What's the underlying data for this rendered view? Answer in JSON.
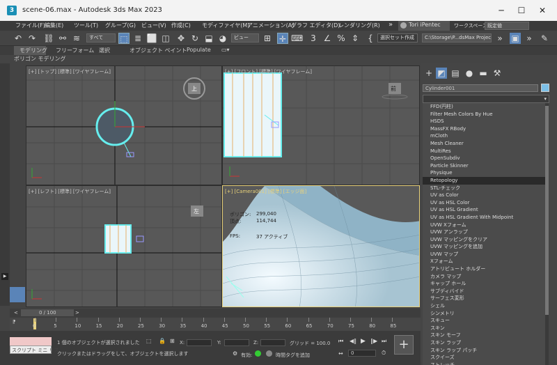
{
  "window": {
    "title": "scene-06.max - Autodesk 3ds Max 2023",
    "logo": "3"
  },
  "menu": [
    "ファイル(F)",
    "編集(E)",
    "ツール(T)",
    "グループ(G)",
    "ビュー(V)",
    "作成(C)",
    "モディファイヤ(M)",
    "アニメーション(A)",
    "グラフ エディタ(D)",
    "レンダリング(R)"
  ],
  "menu_right": {
    "user": "Tori iPentec",
    "workspace_label": "ワークスペース:",
    "workspace_value": "既定値"
  },
  "toolbar": {
    "filter_select": "すべて",
    "view_select": "ビュー",
    "selection_set": "選択セット作成",
    "project_path": "C:\\Storage\\P...dsMax Project"
  },
  "ribbon": {
    "tabs": [
      "モデリング",
      "フリーフォーム",
      "選択",
      "オブジェクト ペイント",
      "Populate"
    ],
    "sub": "ポリゴン モデリング"
  },
  "viewports": {
    "top": "[+] [トップ] [標準] [ワイヤフレーム]",
    "front": "[+] [フロント] [標準] [ワイヤフレーム]",
    "left": "[+] [レフト] [標準] [ワイヤフレーム]",
    "camera": "[+] [Camera001] [標準] [エッジ面]",
    "cam_stats": [
      [
        "ポリゴン:",
        "299,040"
      ],
      [
        "頂点:",
        "114,744"
      ]
    ],
    "fps_label": "FPS:",
    "fps_value": "37 アクティブ",
    "cube_top": "上",
    "cube_front": "前",
    "cube_left": "左"
  },
  "cmdpanel": {
    "object_name": "Cylinder001",
    "modifier_list": [
      "FFD(円柱)",
      "Filter Mesh Colors By Hue",
      "HSDS",
      "MassFX RBody",
      "mCloth",
      "Mesh Cleaner",
      "MultiRes",
      "OpenSubdiv",
      "Particle Skinner",
      "Physique",
      "Retopology",
      "STL-チェック",
      "UV as Color",
      "UV as HSL Color",
      "UV as HSL Gradient",
      "UV as HSL Gradient With Midpoint",
      "UVW Xフォーム",
      "UVW アンラップ",
      "UVW マッピングをクリア",
      "UVW マッピングを追加",
      "UVW マップ",
      "Xフォーム",
      "アトリビュート ホルダー",
      "カメラ マップ",
      "キャップ ホール",
      "サブディバイド",
      "サーフェス変形",
      "シェル",
      "シンメトリ",
      "スキュー",
      "スキン",
      "スキン モーフ",
      "スキン ラップ",
      "スキン ラップ パッチ",
      "スクイーズ",
      "ストレッチ"
    ],
    "selected_index": 10
  },
  "timeline": {
    "frame": "0 / 100",
    "ticks": [
      "0",
      "5",
      "10",
      "15",
      "20",
      "25",
      "30",
      "35",
      "40",
      "45",
      "50",
      "55",
      "60",
      "65",
      "70",
      "75",
      "80",
      "85"
    ]
  },
  "status": {
    "script_label": "スクリプト ミニ リス",
    "selected_msg": "1 個のオブジェクトが選択されました",
    "hint": "クリックまたはドラッグをして、オブジェクトを選択します",
    "x_label": "X:",
    "y_label": "Y:",
    "z_label": "Z:",
    "grid": "グリッド = 100.0",
    "enable_label": "有効:",
    "time_tag": "時間タグを追加",
    "frame_value": "0"
  }
}
